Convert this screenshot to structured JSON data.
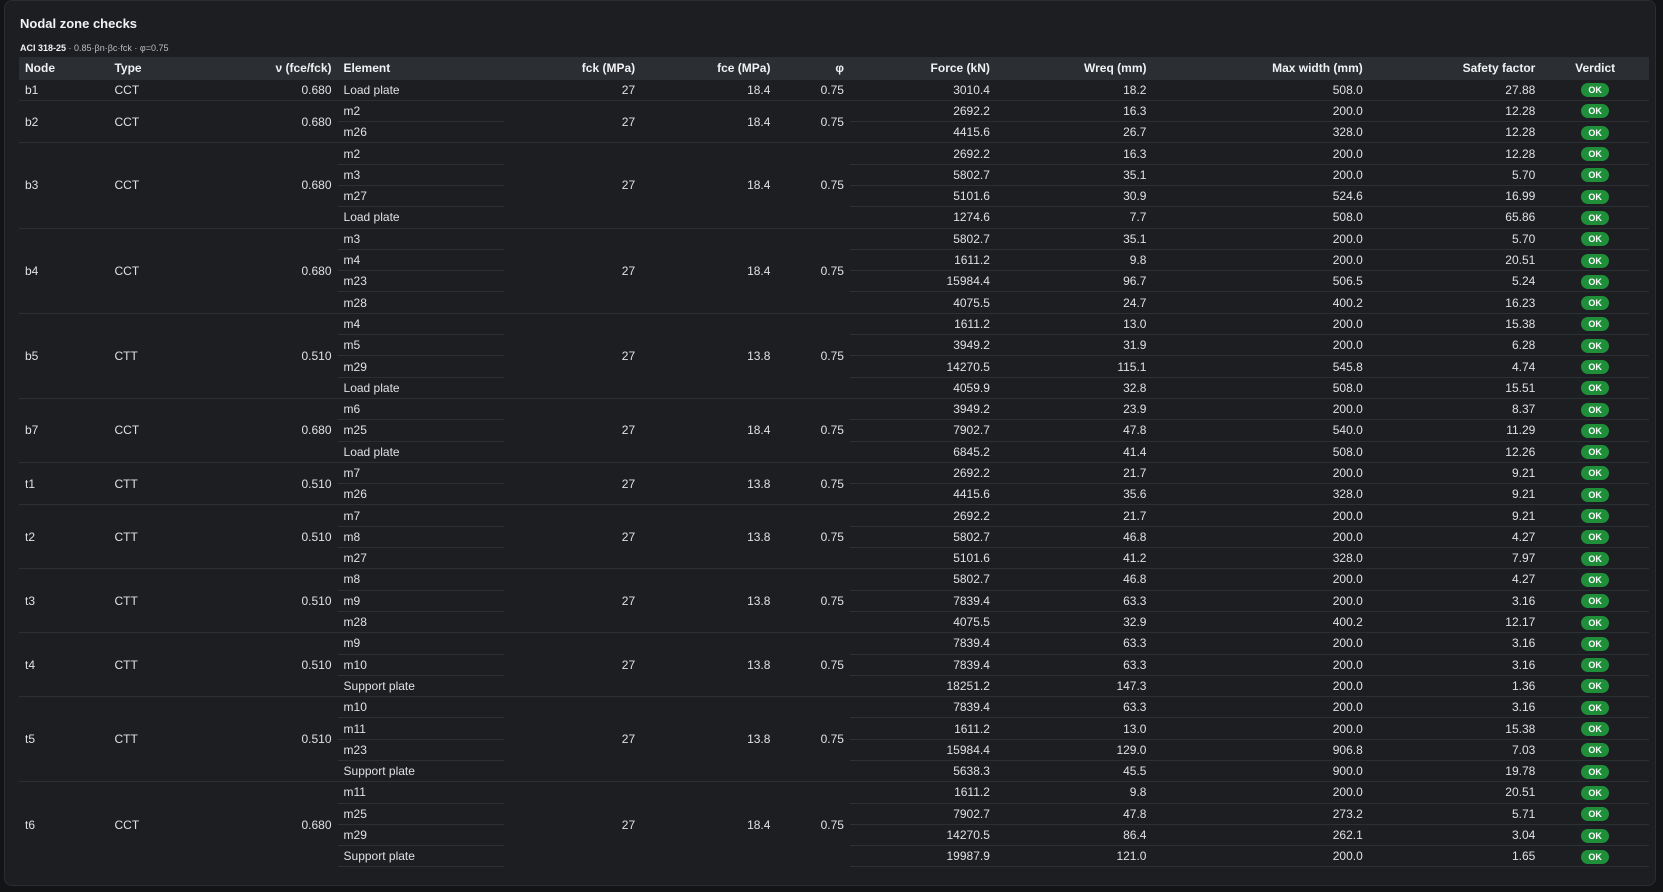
{
  "title": "Nodal zone checks",
  "code": "ACI 318-25",
  "formula": " · 0.85·βn·βc·fck · φ=0.75",
  "columns": [
    "Node",
    "Type",
    "ν (fce/fck)",
    "Element",
    "fck (MPa)",
    "fce (MPa)",
    "φ",
    "Force (kN)",
    "Wreq (mm)",
    "Max width (mm)",
    "Safety factor",
    "Verdict"
  ],
  "nodes": [
    {
      "node": "b1",
      "type": "CCT",
      "nu": "0.680",
      "fck": "27",
      "fce": "18.4",
      "phi": "0.75",
      "rows": [
        {
          "element": "Load plate",
          "force": "3010.4",
          "wreq": "18.2",
          "maxw": "508.0",
          "sf": "27.88",
          "verdict": "OK"
        }
      ]
    },
    {
      "node": "b2",
      "type": "CCT",
      "nu": "0.680",
      "fck": "27",
      "fce": "18.4",
      "phi": "0.75",
      "rows": [
        {
          "element": "m2",
          "force": "2692.2",
          "wreq": "16.3",
          "maxw": "200.0",
          "sf": "12.28",
          "verdict": "OK"
        },
        {
          "element": "m26",
          "force": "4415.6",
          "wreq": "26.7",
          "maxw": "328.0",
          "sf": "12.28",
          "verdict": "OK"
        }
      ]
    },
    {
      "node": "b3",
      "type": "CCT",
      "nu": "0.680",
      "fck": "27",
      "fce": "18.4",
      "phi": "0.75",
      "rows": [
        {
          "element": "m2",
          "force": "2692.2",
          "wreq": "16.3",
          "maxw": "200.0",
          "sf": "12.28",
          "verdict": "OK"
        },
        {
          "element": "m3",
          "force": "5802.7",
          "wreq": "35.1",
          "maxw": "200.0",
          "sf": "5.70",
          "verdict": "OK"
        },
        {
          "element": "m27",
          "force": "5101.6",
          "wreq": "30.9",
          "maxw": "524.6",
          "sf": "16.99",
          "verdict": "OK"
        },
        {
          "element": "Load plate",
          "force": "1274.6",
          "wreq": "7.7",
          "maxw": "508.0",
          "sf": "65.86",
          "verdict": "OK"
        }
      ]
    },
    {
      "node": "b4",
      "type": "CCT",
      "nu": "0.680",
      "fck": "27",
      "fce": "18.4",
      "phi": "0.75",
      "rows": [
        {
          "element": "m3",
          "force": "5802.7",
          "wreq": "35.1",
          "maxw": "200.0",
          "sf": "5.70",
          "verdict": "OK"
        },
        {
          "element": "m4",
          "force": "1611.2",
          "wreq": "9.8",
          "maxw": "200.0",
          "sf": "20.51",
          "verdict": "OK"
        },
        {
          "element": "m23",
          "force": "15984.4",
          "wreq": "96.7",
          "maxw": "506.5",
          "sf": "5.24",
          "verdict": "OK"
        },
        {
          "element": "m28",
          "force": "4075.5",
          "wreq": "24.7",
          "maxw": "400.2",
          "sf": "16.23",
          "verdict": "OK"
        }
      ]
    },
    {
      "node": "b5",
      "type": "CTT",
      "nu": "0.510",
      "fck": "27",
      "fce": "13.8",
      "phi": "0.75",
      "rows": [
        {
          "element": "m4",
          "force": "1611.2",
          "wreq": "13.0",
          "maxw": "200.0",
          "sf": "15.38",
          "verdict": "OK"
        },
        {
          "element": "m5",
          "force": "3949.2",
          "wreq": "31.9",
          "maxw": "200.0",
          "sf": "6.28",
          "verdict": "OK"
        },
        {
          "element": "m29",
          "force": "14270.5",
          "wreq": "115.1",
          "maxw": "545.8",
          "sf": "4.74",
          "verdict": "OK"
        },
        {
          "element": "Load plate",
          "force": "4059.9",
          "wreq": "32.8",
          "maxw": "508.0",
          "sf": "15.51",
          "verdict": "OK"
        }
      ]
    },
    {
      "node": "b7",
      "type": "CCT",
      "nu": "0.680",
      "fck": "27",
      "fce": "18.4",
      "phi": "0.75",
      "rows": [
        {
          "element": "m6",
          "force": "3949.2",
          "wreq": "23.9",
          "maxw": "200.0",
          "sf": "8.37",
          "verdict": "OK"
        },
        {
          "element": "m25",
          "force": "7902.7",
          "wreq": "47.8",
          "maxw": "540.0",
          "sf": "11.29",
          "verdict": "OK"
        },
        {
          "element": "Load plate",
          "force": "6845.2",
          "wreq": "41.4",
          "maxw": "508.0",
          "sf": "12.26",
          "verdict": "OK"
        }
      ]
    },
    {
      "node": "t1",
      "type": "CTT",
      "nu": "0.510",
      "fck": "27",
      "fce": "13.8",
      "phi": "0.75",
      "rows": [
        {
          "element": "m7",
          "force": "2692.2",
          "wreq": "21.7",
          "maxw": "200.0",
          "sf": "9.21",
          "verdict": "OK"
        },
        {
          "element": "m26",
          "force": "4415.6",
          "wreq": "35.6",
          "maxw": "328.0",
          "sf": "9.21",
          "verdict": "OK"
        }
      ]
    },
    {
      "node": "t2",
      "type": "CTT",
      "nu": "0.510",
      "fck": "27",
      "fce": "13.8",
      "phi": "0.75",
      "rows": [
        {
          "element": "m7",
          "force": "2692.2",
          "wreq": "21.7",
          "maxw": "200.0",
          "sf": "9.21",
          "verdict": "OK"
        },
        {
          "element": "m8",
          "force": "5802.7",
          "wreq": "46.8",
          "maxw": "200.0",
          "sf": "4.27",
          "verdict": "OK"
        },
        {
          "element": "m27",
          "force": "5101.6",
          "wreq": "41.2",
          "maxw": "328.0",
          "sf": "7.97",
          "verdict": "OK"
        }
      ]
    },
    {
      "node": "t3",
      "type": "CTT",
      "nu": "0.510",
      "fck": "27",
      "fce": "13.8",
      "phi": "0.75",
      "rows": [
        {
          "element": "m8",
          "force": "5802.7",
          "wreq": "46.8",
          "maxw": "200.0",
          "sf": "4.27",
          "verdict": "OK"
        },
        {
          "element": "m9",
          "force": "7839.4",
          "wreq": "63.3",
          "maxw": "200.0",
          "sf": "3.16",
          "verdict": "OK"
        },
        {
          "element": "m28",
          "force": "4075.5",
          "wreq": "32.9",
          "maxw": "400.2",
          "sf": "12.17",
          "verdict": "OK"
        }
      ]
    },
    {
      "node": "t4",
      "type": "CTT",
      "nu": "0.510",
      "fck": "27",
      "fce": "13.8",
      "phi": "0.75",
      "rows": [
        {
          "element": "m9",
          "force": "7839.4",
          "wreq": "63.3",
          "maxw": "200.0",
          "sf": "3.16",
          "verdict": "OK"
        },
        {
          "element": "m10",
          "force": "7839.4",
          "wreq": "63.3",
          "maxw": "200.0",
          "sf": "3.16",
          "verdict": "OK"
        },
        {
          "element": "Support plate",
          "force": "18251.2",
          "wreq": "147.3",
          "maxw": "200.0",
          "sf": "1.36",
          "verdict": "OK"
        }
      ]
    },
    {
      "node": "t5",
      "type": "CTT",
      "nu": "0.510",
      "fck": "27",
      "fce": "13.8",
      "phi": "0.75",
      "rows": [
        {
          "element": "m10",
          "force": "7839.4",
          "wreq": "63.3",
          "maxw": "200.0",
          "sf": "3.16",
          "verdict": "OK"
        },
        {
          "element": "m11",
          "force": "1611.2",
          "wreq": "13.0",
          "maxw": "200.0",
          "sf": "15.38",
          "verdict": "OK"
        },
        {
          "element": "m23",
          "force": "15984.4",
          "wreq": "129.0",
          "maxw": "906.8",
          "sf": "7.03",
          "verdict": "OK"
        },
        {
          "element": "Support plate",
          "force": "5638.3",
          "wreq": "45.5",
          "maxw": "900.0",
          "sf": "19.78",
          "verdict": "OK"
        }
      ]
    },
    {
      "node": "t6",
      "type": "CCT",
      "nu": "0.680",
      "fck": "27",
      "fce": "18.4",
      "phi": "0.75",
      "rows": [
        {
          "element": "m11",
          "force": "1611.2",
          "wreq": "9.8",
          "maxw": "200.0",
          "sf": "20.51",
          "verdict": "OK"
        },
        {
          "element": "m25",
          "force": "7902.7",
          "wreq": "47.8",
          "maxw": "273.2",
          "sf": "5.71",
          "verdict": "OK"
        },
        {
          "element": "m29",
          "force": "14270.5",
          "wreq": "86.4",
          "maxw": "262.1",
          "sf": "3.04",
          "verdict": "OK"
        },
        {
          "element": "Support plate",
          "force": "19987.9",
          "wreq": "121.0",
          "maxw": "200.0",
          "sf": "1.65",
          "verdict": "OK"
        }
      ]
    }
  ],
  "colors": {
    "panel": "#1c1e21",
    "header": "#2b2e33",
    "ok_badge": "#1f8f3a"
  }
}
